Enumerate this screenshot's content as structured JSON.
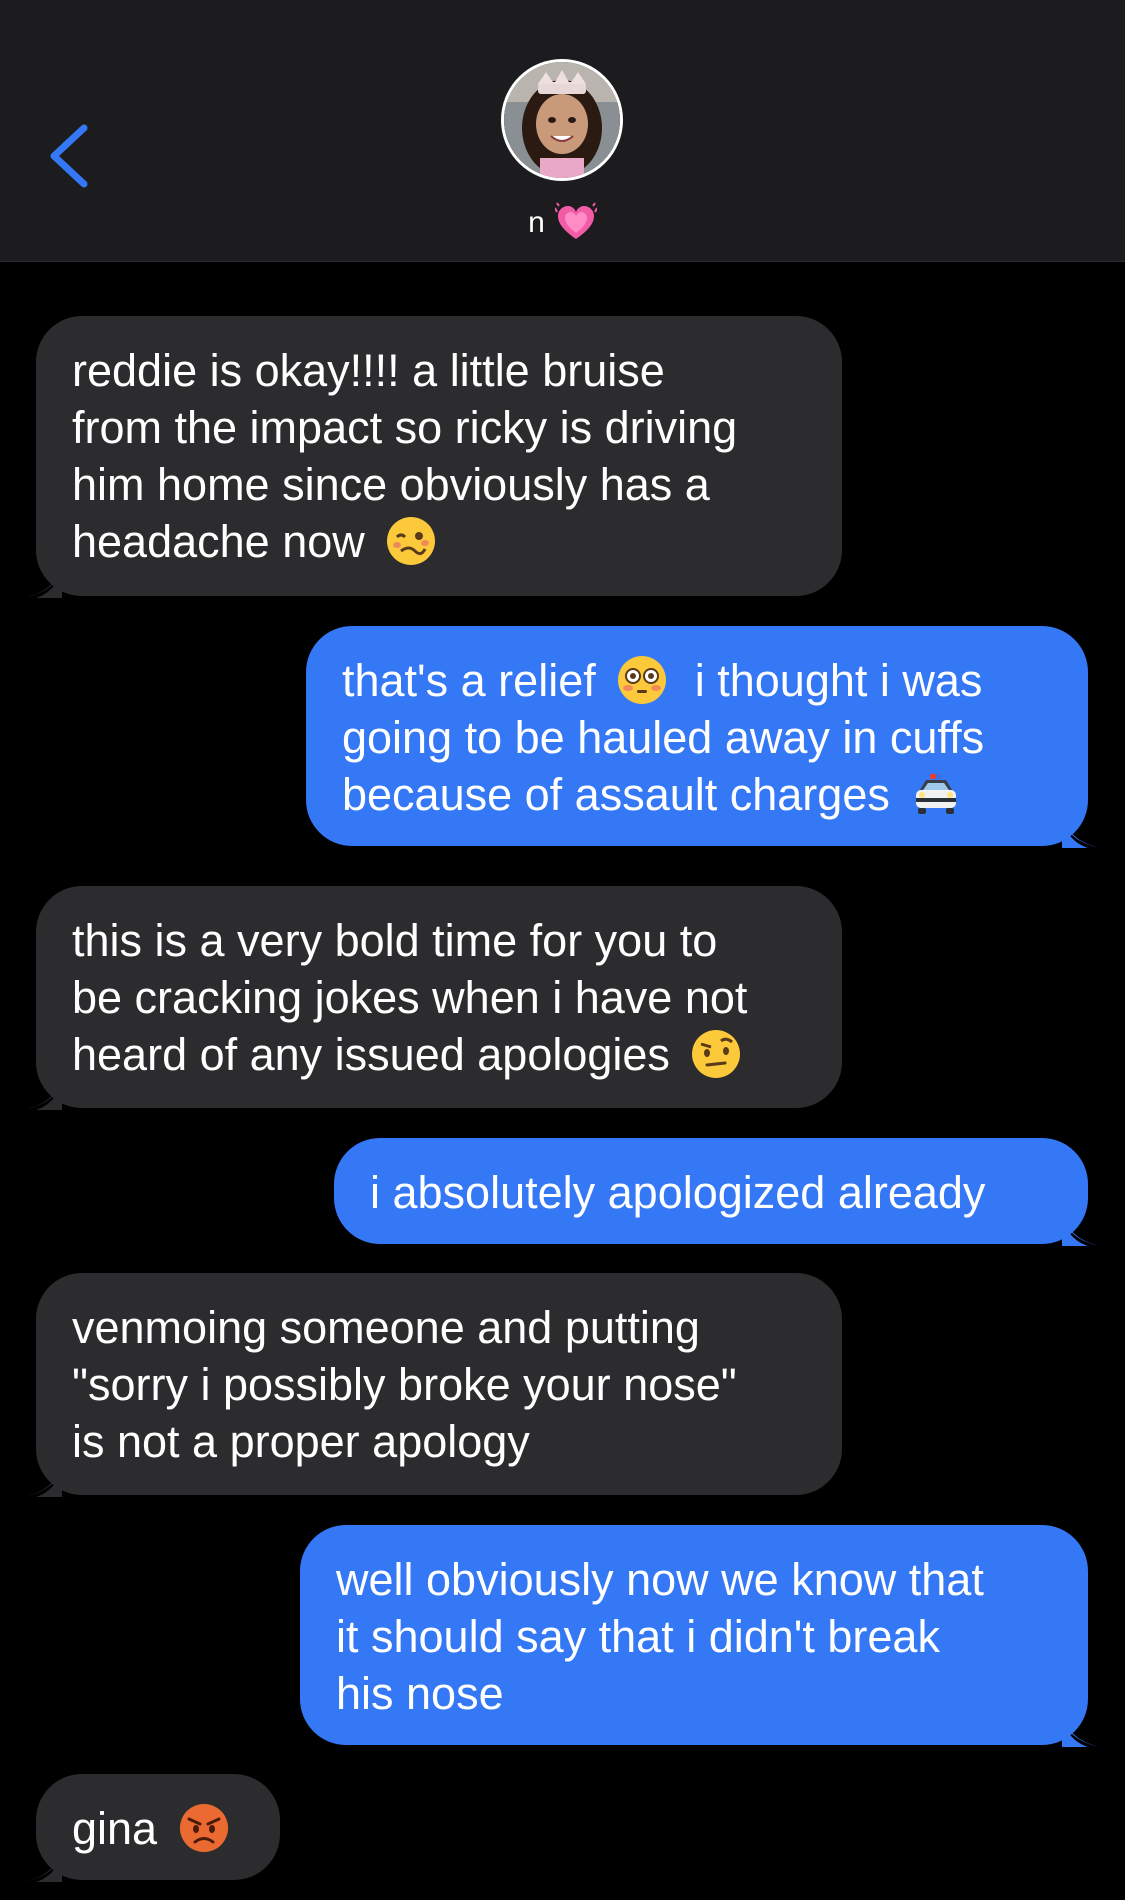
{
  "header": {
    "contact_name": "n",
    "name_emoji": "heart-icon",
    "back_icon": "chevron-left-icon"
  },
  "colors": {
    "background": "#000000",
    "header_bg": "#1c1c1e",
    "received_bubble": "#2c2c2e",
    "sent_bubble": "#3478f6",
    "accent": "#3478f6"
  },
  "messages": [
    {
      "direction": "received",
      "lines": [
        "reddie is okay!!!! a little bruise",
        "from the impact so ricky is driving",
        "him home since obviously has a",
        "headache now"
      ],
      "emoji": "woozy-face-emoji"
    },
    {
      "direction": "sent",
      "lines": [
        "that's a relief",
        "going to be hauled away in cuffs",
        "because of assault charges"
      ],
      "line1_after_emoji": "i thought i was",
      "emoji_1": "flushed-face-emoji",
      "emoji_2": "police-car-emoji"
    },
    {
      "direction": "received",
      "lines": [
        "this is a very bold time for you to",
        "be cracking jokes when i have not",
        "heard of any issued apologies"
      ],
      "emoji": "raised-eyebrow-face-emoji"
    },
    {
      "direction": "sent",
      "lines": [
        "i absolutely apologized already"
      ]
    },
    {
      "direction": "received",
      "lines": [
        "venmoing someone and putting",
        "\"sorry i possibly broke your nose\"",
        "is not a proper apology"
      ]
    },
    {
      "direction": "sent",
      "lines": [
        "well obviously now we know that",
        "it should say that i didn't break",
        "his nose"
      ]
    },
    {
      "direction": "received",
      "lines": [
        "gina"
      ],
      "emoji": "angry-face-emoji"
    }
  ]
}
